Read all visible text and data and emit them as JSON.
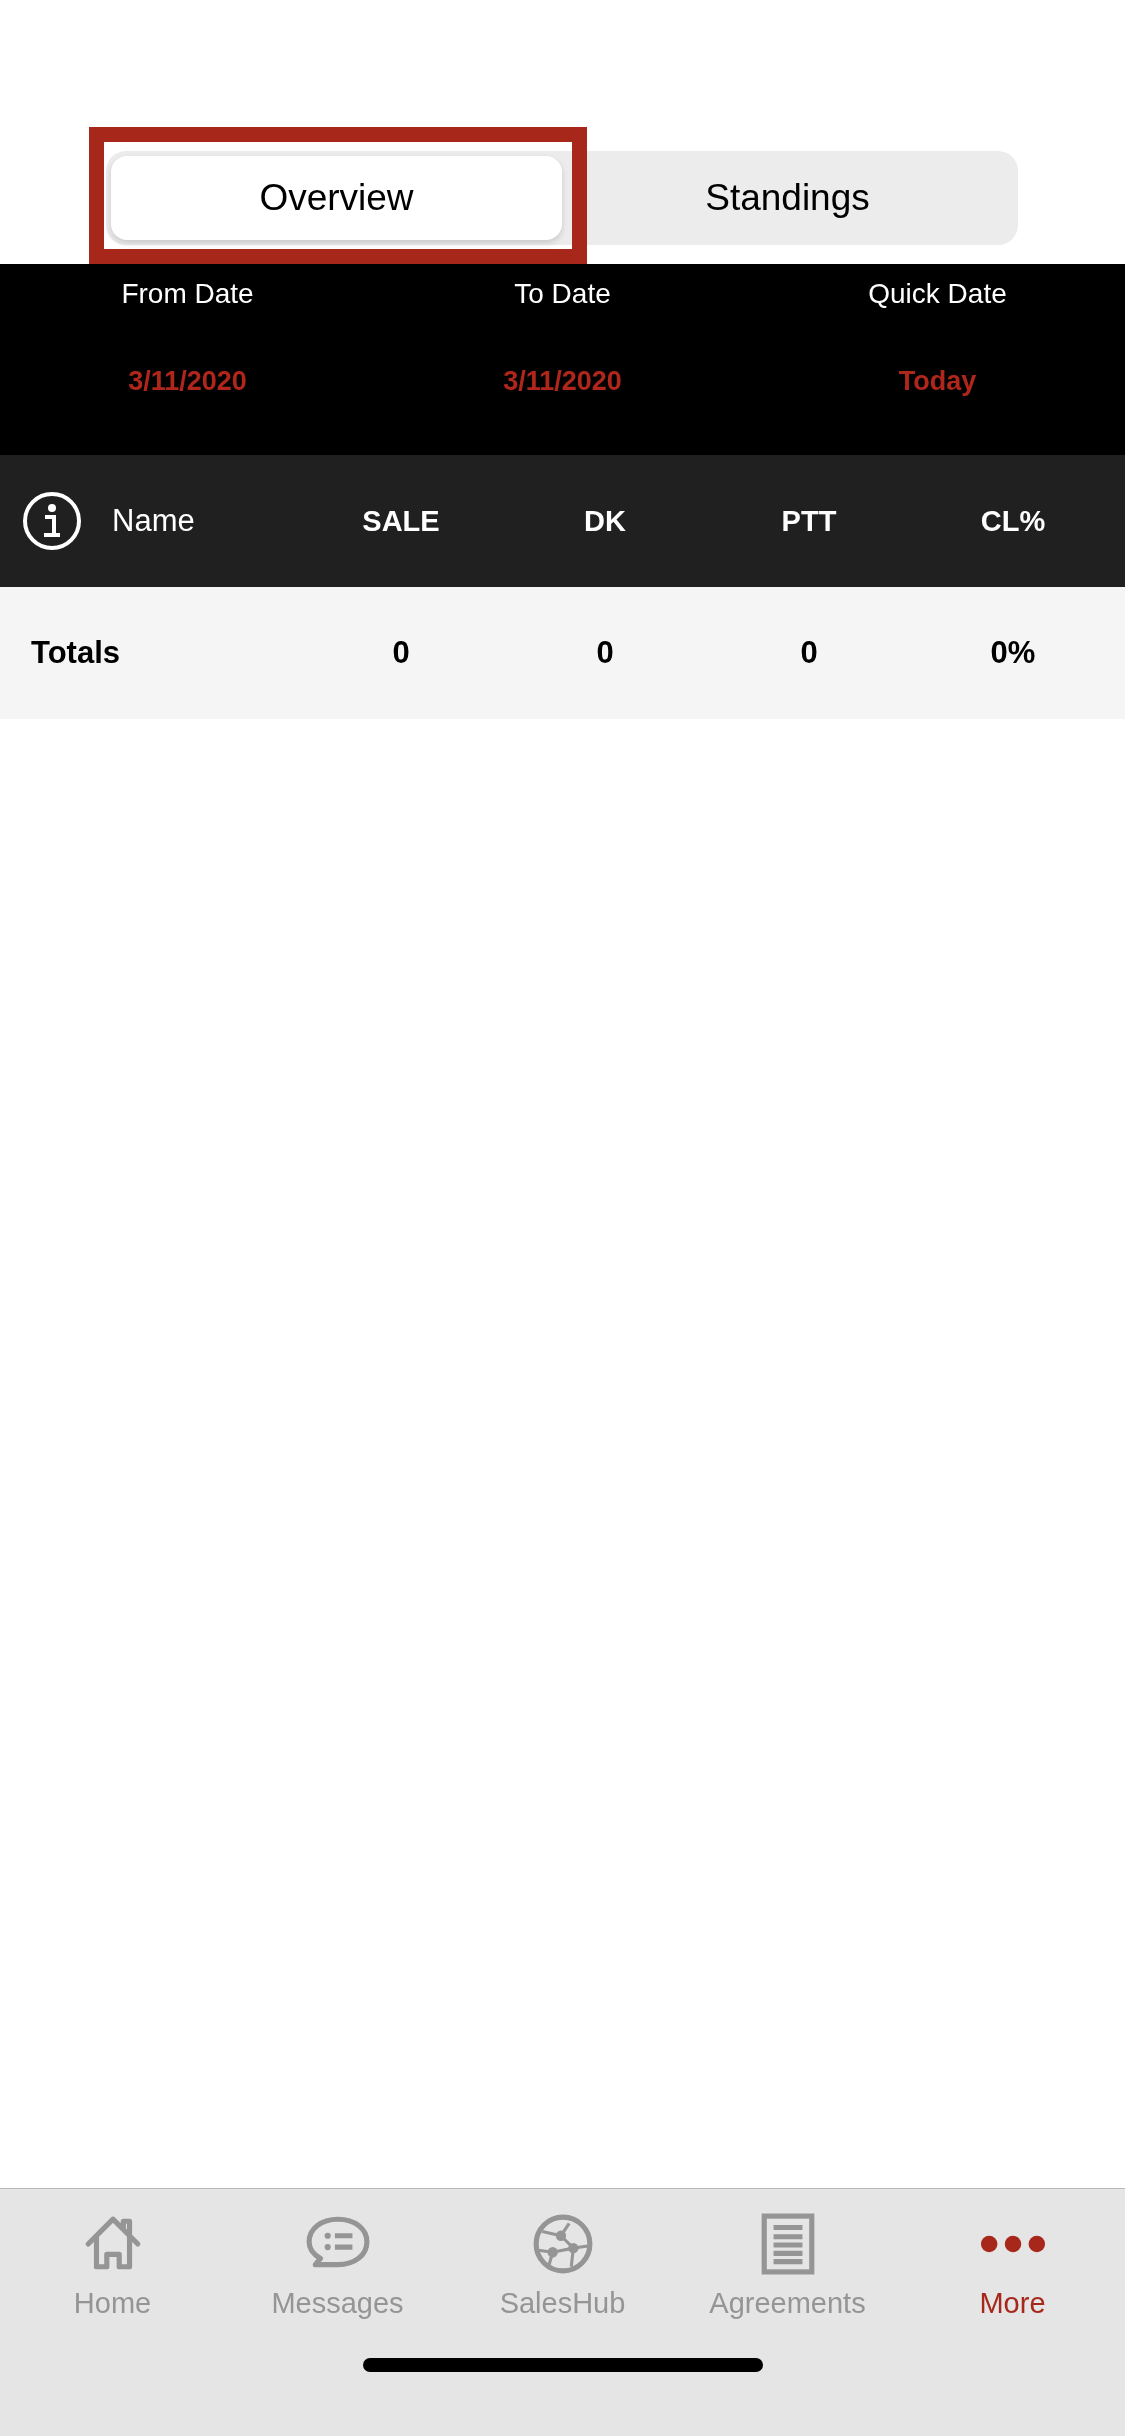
{
  "segments": [
    {
      "label": "Overview",
      "selected": true,
      "highlighted": true
    },
    {
      "label": "Standings",
      "selected": false,
      "highlighted": false
    }
  ],
  "dates": [
    {
      "label": "From Date",
      "value": "3/11/2020"
    },
    {
      "label": "To Date",
      "value": "3/11/2020"
    },
    {
      "label": "Quick Date",
      "value": "Today"
    }
  ],
  "table": {
    "columns": [
      "Name",
      "SALE",
      "DK",
      "PTT",
      "CL%"
    ],
    "rows": [
      {
        "cells": [
          "Totals",
          "0",
          "0",
          "0",
          "0%"
        ]
      }
    ]
  },
  "tab_bar": [
    {
      "label": "Home",
      "selected": false
    },
    {
      "label": "Messages",
      "selected": false
    },
    {
      "label": "SalesHub",
      "selected": false
    },
    {
      "label": "Agreements",
      "selected": false
    },
    {
      "label": "More",
      "selected": true
    }
  ]
}
